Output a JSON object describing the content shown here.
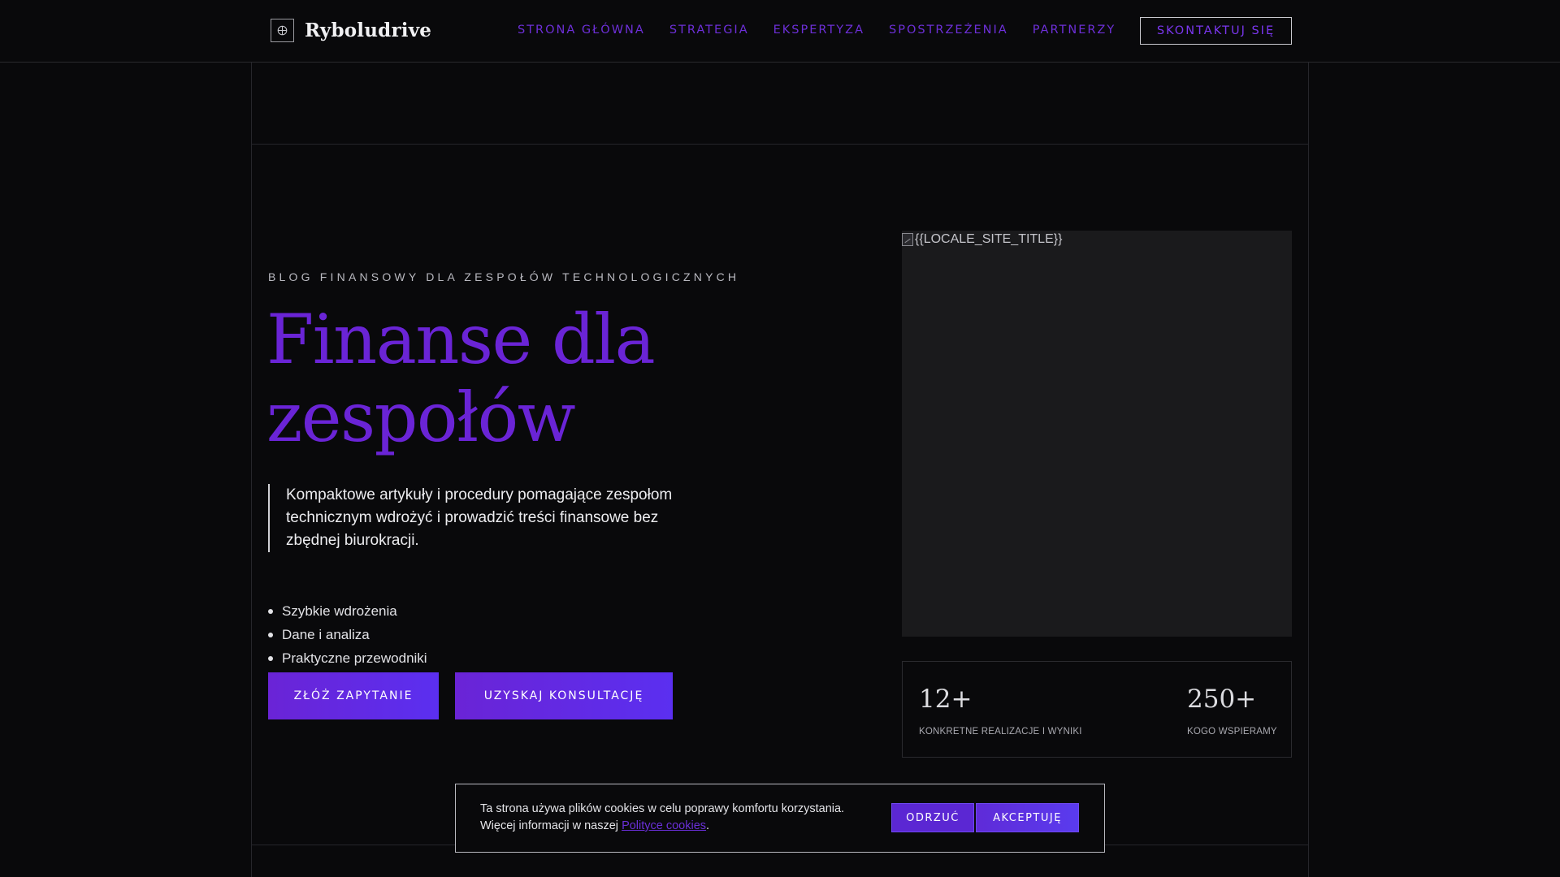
{
  "header": {
    "brand": "Ryboludrive",
    "nav": [
      {
        "label": "STRONA GŁÓWNA"
      },
      {
        "label": "STRATEGIA"
      },
      {
        "label": "EKSPERTYZA"
      },
      {
        "label": "SPOSTRZEŻENIA"
      },
      {
        "label": "PARTNERZY"
      }
    ],
    "cta_label": "SKONTAKTUJ SIĘ"
  },
  "hero": {
    "eyebrow": "BLOG FINANSOWY DLA ZESPOŁÓW TECHNOLOGICZNYCH",
    "title_line1": "Finanse dla",
    "title_line2": "zespołów",
    "lead": "Kompaktowe artykuły i procedury pomagające zespołom technicznym wdrożyć i prowadzić treści finansowe bez zbędnej biurokracji.",
    "features": [
      "Szybkie wdrożenia",
      "Dane i analiza",
      "Praktyczne przewodniki"
    ],
    "primary_button": "ZŁÓŻ ZAPYTANIE",
    "secondary_button": "UZYSKAJ KONSULTACJĘ",
    "image_alt": "{{LOCALE_SITE_TITLE}}"
  },
  "stats": [
    {
      "value": "12+",
      "label": "KONKRETNE REALIZACJE I WYNIKI"
    },
    {
      "value": "250+",
      "label": "KOGO WSPIERAMY"
    }
  ],
  "cookie": {
    "text_line1": "Ta strona używa plików cookies w celu poprawy komfortu korzystania.",
    "text_line2_prefix": "Więcej informacji w naszej ",
    "link_text": "Polityce cookies",
    "text_suffix": ".",
    "reject_label": "ODRZUĆ",
    "accept_label": "AKCEPTUJĘ"
  },
  "colors": {
    "background": "#09090b",
    "accent": "#6a24d6",
    "accent_button": "#5b2ff0",
    "text": "#e8e8ea"
  }
}
